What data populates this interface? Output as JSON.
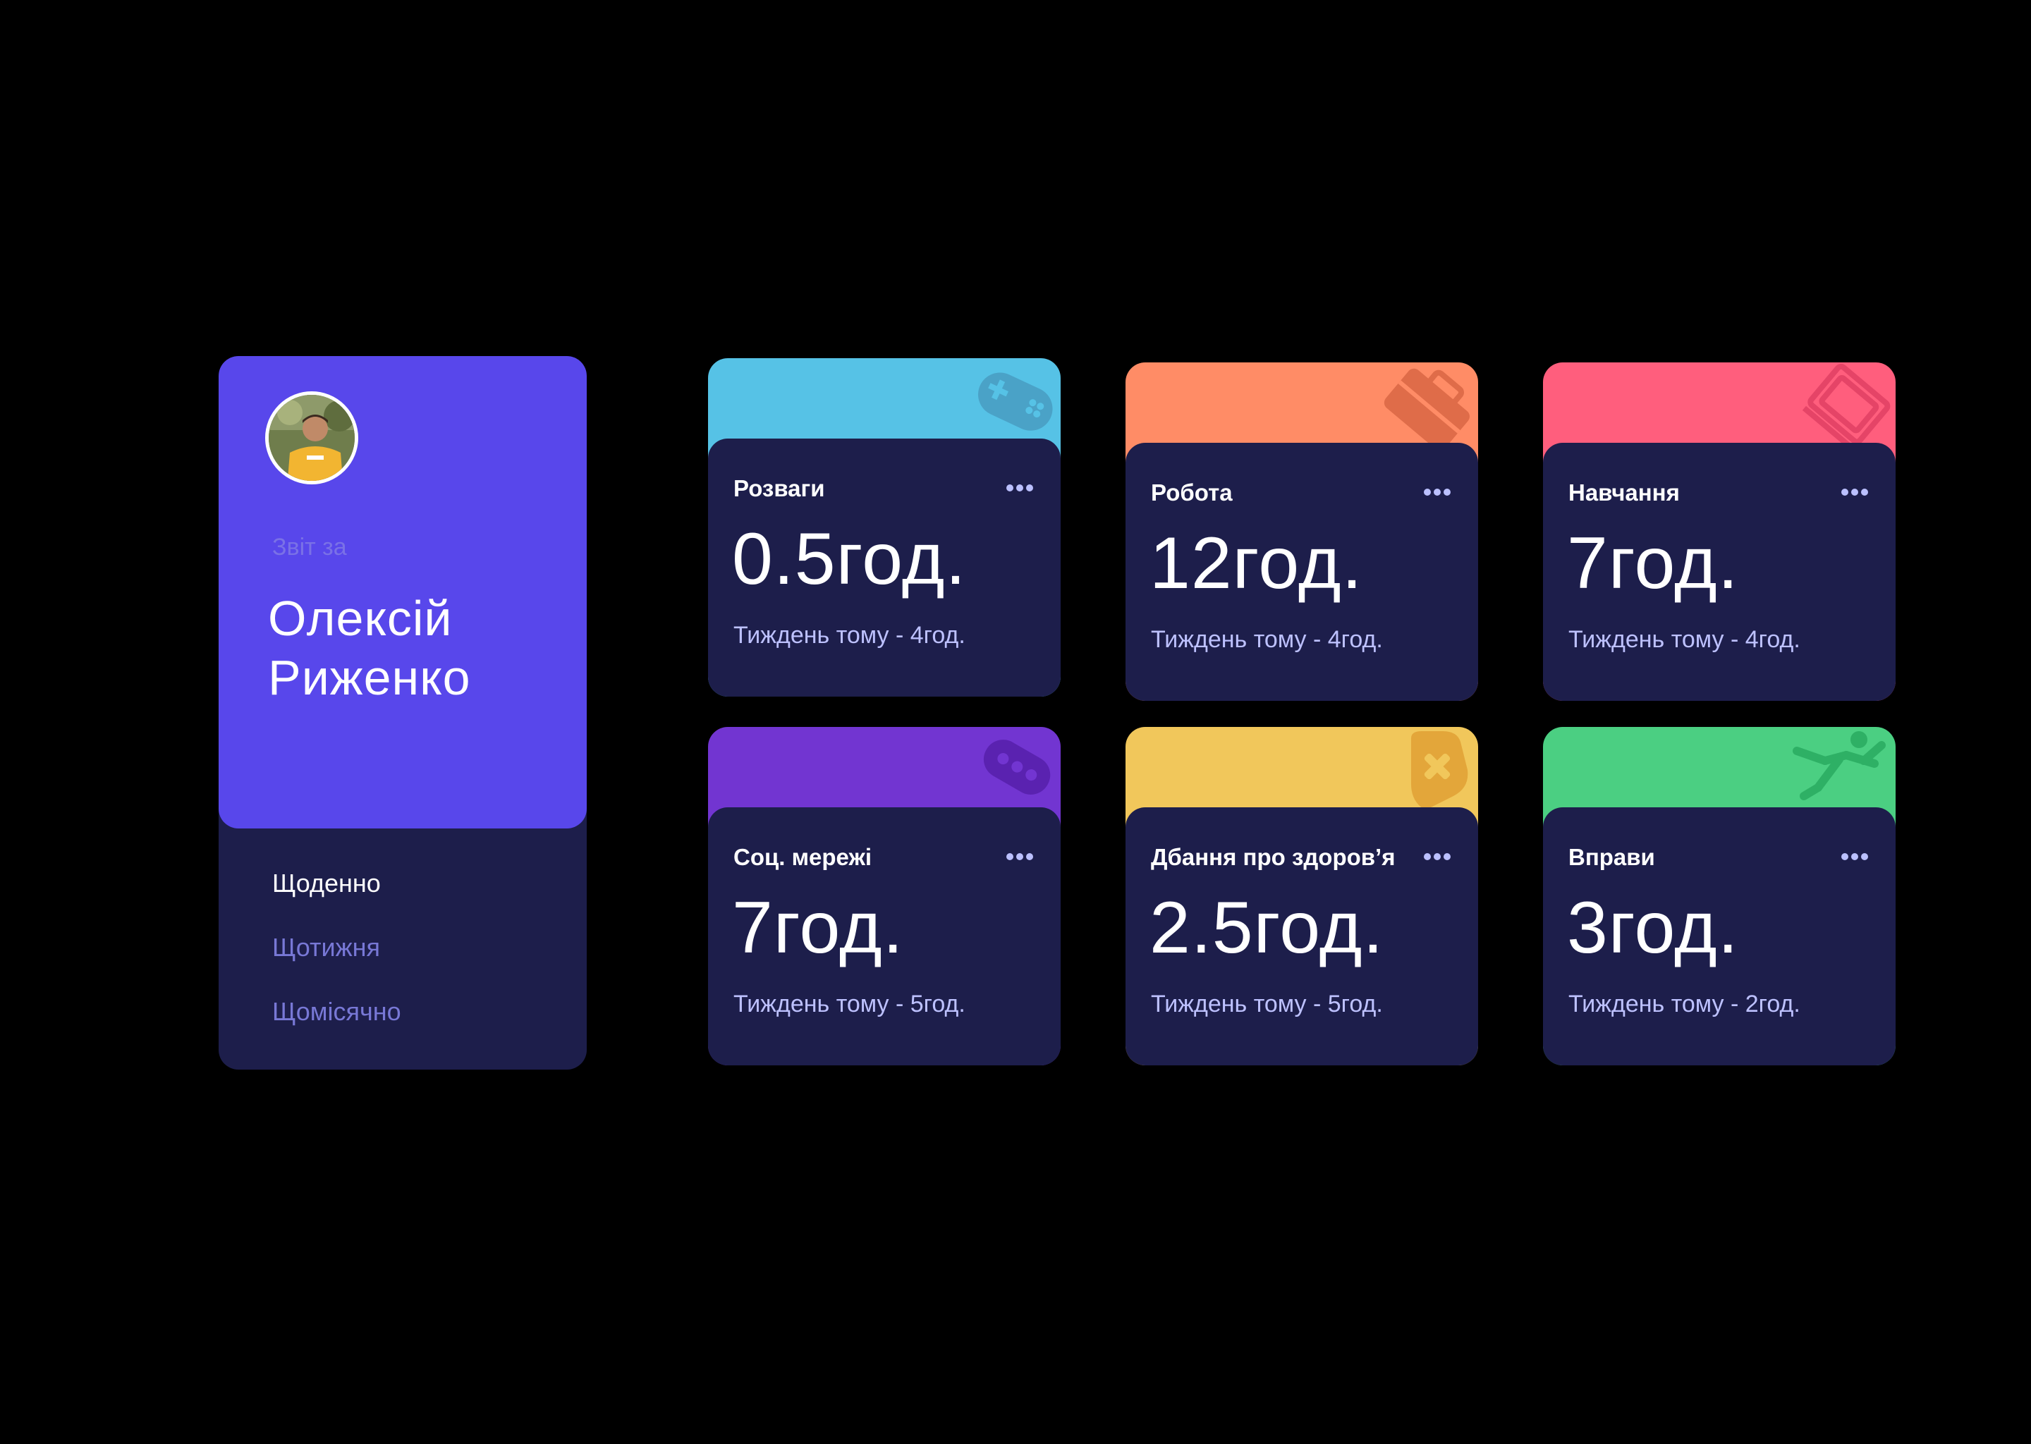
{
  "profile": {
    "report_label": "Звіт за",
    "name": "Олексій Риженко",
    "avatar_alt": "avatar",
    "periods": [
      {
        "label": "Щоденно",
        "active": true
      },
      {
        "label": "Щотижня",
        "active": false
      },
      {
        "label": "Щомісячно",
        "active": false
      }
    ]
  },
  "activities": [
    {
      "title": "Розваги",
      "hours": "0.5год.",
      "previous": "Тиждень тому - 4год.",
      "color": "#56c2e6",
      "icon": "gamepad-icon",
      "icon_color": "#4aa2c7"
    },
    {
      "title": "Робота",
      "hours": "12год.",
      "previous": "Тиждень тому - 4год.",
      "color": "#ff8c66",
      "icon": "briefcase-icon",
      "icon_color": "#df6c49"
    },
    {
      "title": "Навчання",
      "hours": "7год.",
      "previous": "Тиждень тому - 4год.",
      "color": "#ff5e7d",
      "icon": "book-icon",
      "icon_color": "#e54467"
    },
    {
      "title": "Соц. мережі",
      "hours": "7год.",
      "previous": "Тиждень тому - 5год.",
      "color": "#7235d1",
      "icon": "social-icon",
      "icon_color": "#5a22b0"
    },
    {
      "title": "Дбання про здоров’я",
      "hours": "2.5год.",
      "previous": "Тиждень тому - 5год.",
      "color": "#f1c75b",
      "icon": "health-heart-icon",
      "icon_color": "#e3a63a"
    },
    {
      "title": "Вправи",
      "hours": "3год.",
      "previous": "Тиждень тому - 2год.",
      "color": "#4bcf82",
      "icon": "exercise-icon",
      "icon_color": "#2eb065"
    }
  ]
}
